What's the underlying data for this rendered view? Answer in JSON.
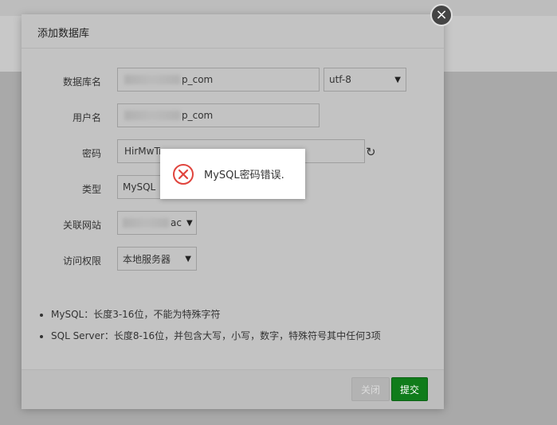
{
  "dialog": {
    "title": "添加数据库",
    "close_symbol": "×"
  },
  "form": {
    "db_name_label": "数据库名",
    "db_name_value_suffix": "p_com",
    "charset_value": "utf-8",
    "username_label": "用户名",
    "username_value_suffix": "p_com",
    "password_label": "密码",
    "password_value": "HirMwTr",
    "type_label": "类型",
    "type_value": "MySQL",
    "site_label": "关联网站",
    "site_value_suffix": "ac",
    "access_label": "访问权限",
    "access_value": "本地服务器"
  },
  "notes": [
    "MySQL：长度3-16位，不能为特殊字符",
    "SQL Server：长度8-16位，并包含大写，小写，数字，特殊符号其中任何3项"
  ],
  "footer": {
    "close_label": "关闭",
    "submit_label": "提交"
  },
  "toast": {
    "message": "MySQL密码错误."
  },
  "colors": {
    "submit": "#107c1b",
    "error": "#e0443d"
  }
}
